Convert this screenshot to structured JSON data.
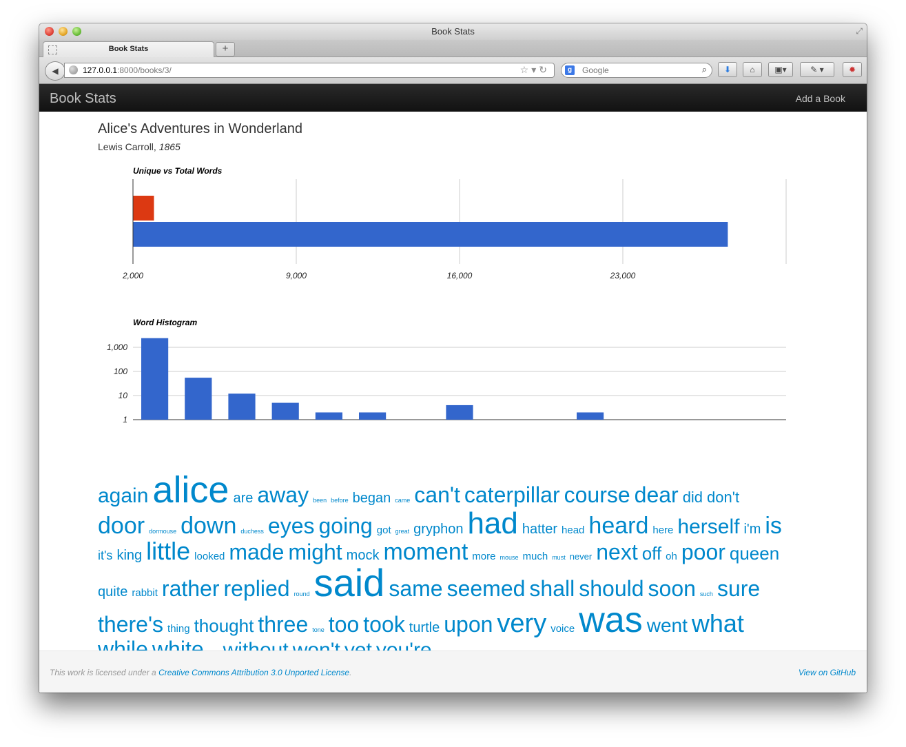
{
  "window": {
    "title": "Book Stats"
  },
  "tab": {
    "label": "Book Stats"
  },
  "toolbar": {
    "url_host": "127.0.0.1",
    "url_path": ":8000/books/3/",
    "search_placeholder": "Google"
  },
  "site": {
    "brand": "Book Stats",
    "add_book": "Add a Book"
  },
  "book": {
    "title": "Alice's Adventures in Wonderland",
    "author": "Lewis Carroll,",
    "year": "1865"
  },
  "chart_data": [
    {
      "type": "bar",
      "orientation": "horizontal",
      "title": "Unique vs Total Words",
      "series": [
        {
          "values": [
            2900
          ],
          "color": "#dc3912"
        },
        {
          "values": [
            27500
          ],
          "color": "#3366cc"
        }
      ],
      "xlim": [
        2000,
        30000
      ],
      "xticks": [
        "2,000",
        "9,000",
        "16,000",
        "23,000"
      ],
      "grid": true
    },
    {
      "type": "bar",
      "title": "Word Histogram",
      "yscale": "log",
      "yticks": [
        "1,000",
        "100",
        "10",
        "1"
      ],
      "values": [
        2400,
        55,
        12,
        5,
        2,
        2,
        0,
        4,
        0,
        0,
        2,
        0,
        0,
        0,
        0
      ],
      "color": "#3366cc",
      "grid": true
    }
  ],
  "cloud": [
    {
      "w": "again",
      "s": 30
    },
    {
      "w": "alice",
      "s": 54
    },
    {
      "w": "are",
      "s": 20
    },
    {
      "w": "away",
      "s": 32
    },
    {
      "w": "been",
      "s": 9
    },
    {
      "w": "before",
      "s": 9
    },
    {
      "w": "began",
      "s": 20
    },
    {
      "w": "came",
      "s": 9
    },
    {
      "w": "can't",
      "s": 32
    },
    {
      "w": "caterpillar",
      "s": 32
    },
    {
      "w": "course",
      "s": 32
    },
    {
      "w": "dear",
      "s": 32
    },
    {
      "w": "did",
      "s": 22
    },
    {
      "w": "don't",
      "s": 22
    },
    {
      "w": "door",
      "s": 34
    },
    {
      "w": "dormouse",
      "s": 9
    },
    {
      "w": "down",
      "s": 34
    },
    {
      "w": "duchess",
      "s": 9
    },
    {
      "w": "eyes",
      "s": 32
    },
    {
      "w": "going",
      "s": 32
    },
    {
      "w": "got",
      "s": 15
    },
    {
      "w": "great",
      "s": 9
    },
    {
      "w": "gryphon",
      "s": 20
    },
    {
      "w": "had",
      "s": 44
    },
    {
      "w": "hatter",
      "s": 20
    },
    {
      "w": "head",
      "s": 15
    },
    {
      "w": "heard",
      "s": 34
    },
    {
      "w": "here",
      "s": 15
    },
    {
      "w": "herself",
      "s": 30
    },
    {
      "w": "i'm",
      "s": 20
    },
    {
      "w": "is",
      "s": 34
    },
    {
      "w": "it's",
      "s": 18
    },
    {
      "w": "king",
      "s": 20
    },
    {
      "w": "little",
      "s": 36
    },
    {
      "w": "looked",
      "s": 15
    },
    {
      "w": "made",
      "s": 32
    },
    {
      "w": "might",
      "s": 32
    },
    {
      "w": "mock",
      "s": 20
    },
    {
      "w": "moment",
      "s": 34
    },
    {
      "w": "more",
      "s": 15
    },
    {
      "w": "mouse",
      "s": 9
    },
    {
      "w": "much",
      "s": 15
    },
    {
      "w": "must",
      "s": 9
    },
    {
      "w": "never",
      "s": 13
    },
    {
      "w": "next",
      "s": 32
    },
    {
      "w": "off",
      "s": 26
    },
    {
      "w": "oh",
      "s": 15
    },
    {
      "w": "poor",
      "s": 32
    },
    {
      "w": "queen",
      "s": 26
    },
    {
      "w": "quite",
      "s": 20
    },
    {
      "w": "rabbit",
      "s": 15
    },
    {
      "w": "rather",
      "s": 32
    },
    {
      "w": "replied",
      "s": 32
    },
    {
      "w": "round",
      "s": 9
    },
    {
      "w": "said",
      "s": 56
    },
    {
      "w": "same",
      "s": 32
    },
    {
      "w": "seemed",
      "s": 32
    },
    {
      "w": "shall",
      "s": 32
    },
    {
      "w": "should",
      "s": 32
    },
    {
      "w": "soon",
      "s": 32
    },
    {
      "w": "such",
      "s": 9
    },
    {
      "w": "sure",
      "s": 32
    },
    {
      "w": "there's",
      "s": 32
    },
    {
      "w": "thing",
      "s": 15
    },
    {
      "w": "thought",
      "s": 26
    },
    {
      "w": "three",
      "s": 32
    },
    {
      "w": "tone",
      "s": 9
    },
    {
      "w": "too",
      "s": 32
    },
    {
      "w": "took",
      "s": 32
    },
    {
      "w": "turtle",
      "s": 20
    },
    {
      "w": "upon",
      "s": 32
    },
    {
      "w": "very",
      "s": 38
    },
    {
      "w": "voice",
      "s": 15
    },
    {
      "w": "was",
      "s": 52
    },
    {
      "w": "went",
      "s": 28
    },
    {
      "w": "what",
      "s": 36
    },
    {
      "w": "while",
      "s": 32
    },
    {
      "w": "white",
      "s": 32
    },
    {
      "w": "why",
      "s": 9
    },
    {
      "w": "without",
      "s": 30
    },
    {
      "w": "won't",
      "s": 30
    },
    {
      "w": "yet",
      "s": 30
    },
    {
      "w": "you're",
      "s": 30
    }
  ],
  "footer": {
    "license_prefix": "This work is licensed under a",
    "license_link": "Creative Commons Attribution 3.0 Unported License",
    "license_suffix": ".",
    "github": "View on GitHub"
  }
}
